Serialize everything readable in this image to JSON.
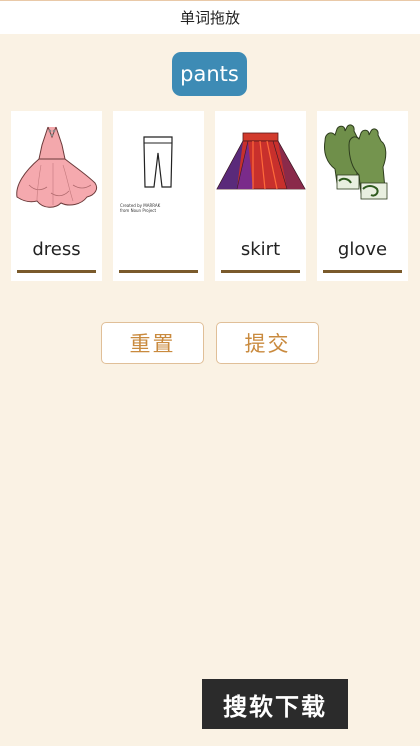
{
  "header": {
    "title": "单词拖放"
  },
  "target_word": "pants",
  "cards": [
    {
      "label": "dress",
      "icon": "dress-icon"
    },
    {
      "label": "",
      "icon": "pants-icon",
      "credit_line1": "Created by MARRAK",
      "credit_line2": "from Noun Project"
    },
    {
      "label": "skirt",
      "icon": "skirt-icon"
    },
    {
      "label": "glove",
      "icon": "glove-icon"
    }
  ],
  "buttons": {
    "reset": "重置",
    "submit": "提交"
  },
  "watermark": "搜软下载",
  "colors": {
    "background": "#faf2e4",
    "word_chip": "#3d8bb5",
    "button_text": "#c98a3e",
    "underline": "#7a5a2b"
  }
}
